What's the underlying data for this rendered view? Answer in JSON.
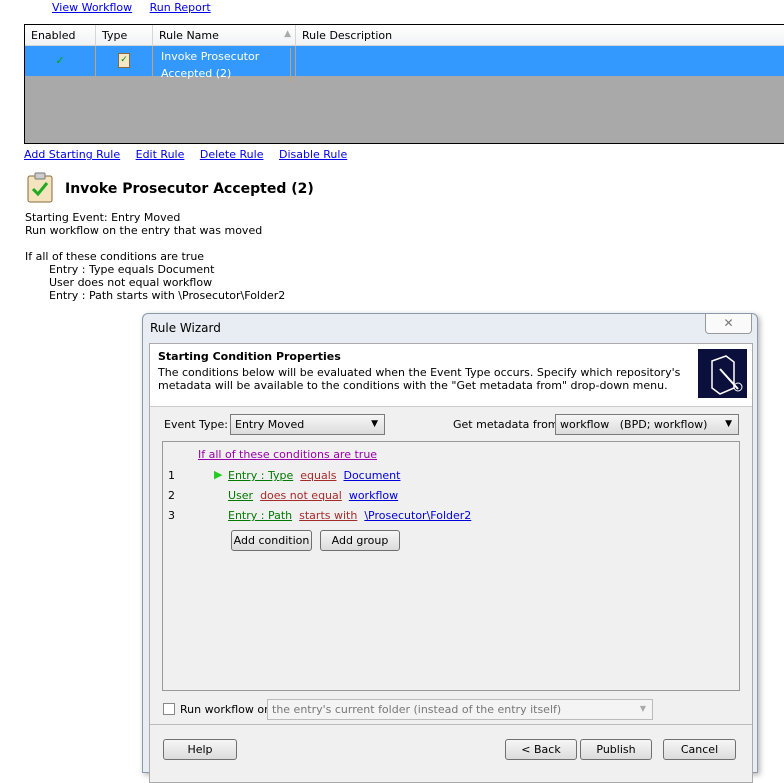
{
  "top_links": [
    "View Workflow",
    "Run Report"
  ],
  "table": {
    "headers": [
      "Enabled",
      "Type",
      "Rule Name",
      "Rule Description"
    ],
    "rows": [
      {
        "enabled": "✓",
        "type_icon": "clipboard-check-icon",
        "name_line1": "Invoke Prosecutor",
        "name_line2": "Accepted (2)",
        "description": ""
      }
    ]
  },
  "actions": [
    "Add Starting Rule",
    "Edit Rule",
    "Delete Rule",
    "Disable Rule"
  ],
  "rule": {
    "title": "Invoke Prosecutor Accepted (2)",
    "starting_event": "Starting Event: Entry Moved",
    "run_on": "Run workflow on the entry that was moved",
    "conditions_header": "If all of these conditions are true",
    "conditions": [
      "Entry : Type equals Document",
      "User does not equal workflow",
      "Entry : Path starts with \\Prosecutor\\Folder2"
    ]
  },
  "dialog": {
    "title": "Rule Wizard",
    "close": "✕",
    "heading": "Starting Condition Properties",
    "description": "The conditions below will be evaluated when the Event Type occurs. Specify which repository's metadata will be available to the conditions with the \"Get metadata from\" drop-down menu.",
    "event_type_label": "Event Type:",
    "event_type_value": "Entry Moved",
    "metadata_label": "Get metadata from:",
    "metadata_value": "workflow   (BPD; workflow)",
    "group_label": "If all of these conditions are true",
    "conditions": [
      {
        "num": "1",
        "field": "Entry : Type",
        "op": "equals",
        "value": "Document"
      },
      {
        "num": "2",
        "field": "User",
        "op": "does not equal",
        "value": "workflow"
      },
      {
        "num": "3",
        "field": "Entry : Path",
        "op": "starts with",
        "value": "\\Prosecutor\\Folder2"
      }
    ],
    "add_condition": "Add condition",
    "add_group": "Add group",
    "run_workflow_label": "Run workflow on",
    "run_workflow_value": "the entry's current folder (instead of the entry itself)",
    "help": "Help",
    "back": "< Back",
    "publish": "Publish",
    "cancel": "Cancel"
  },
  "colors": {
    "selection": "#3399ff",
    "grid_bg": "#a9a9a9"
  }
}
